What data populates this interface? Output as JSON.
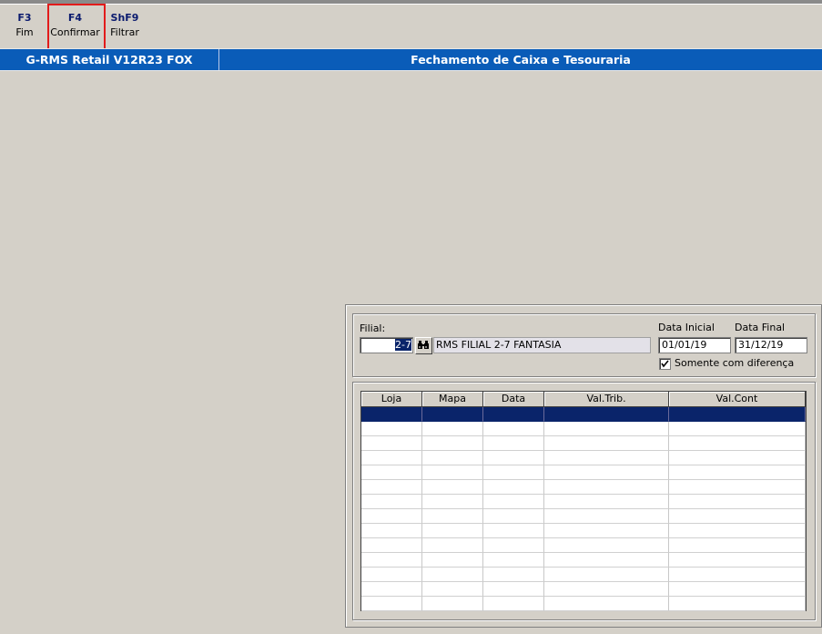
{
  "toolbar": {
    "keys": [
      {
        "key": "F3",
        "label": "Fim"
      },
      {
        "key": "F4",
        "label": "Confirmar"
      },
      {
        "key": "ShF9",
        "label": "Filtrar"
      }
    ]
  },
  "titlebar": {
    "app": "G-RMS Retail V12R23 FOX",
    "module": "Fechamento de Caixa e Tesouraria"
  },
  "filter": {
    "filial_label": "Filial:",
    "filial_value": "2-7",
    "filial_description": "RMS FILIAL 2-7 FANTASIA",
    "lookup_icon": "binoculars-icon",
    "data_inicial_label": "Data Inicial",
    "data_inicial_value": "01/01/19",
    "data_final_label": "Data Final",
    "data_final_value": "31/12/19",
    "somente_label": "Somente com diferença",
    "somente_checked": true
  },
  "grid": {
    "columns": [
      "Loja",
      "Mapa",
      "Data",
      "Val.Trib.",
      "Val.Cont"
    ],
    "rows": [
      [
        "",
        "",
        "",
        "",
        ""
      ],
      [
        "",
        "",
        "",
        "",
        ""
      ],
      [
        "",
        "",
        "",
        "",
        ""
      ],
      [
        "",
        "",
        "",
        "",
        ""
      ],
      [
        "",
        "",
        "",
        "",
        ""
      ],
      [
        "",
        "",
        "",
        "",
        ""
      ],
      [
        "",
        "",
        "",
        "",
        ""
      ],
      [
        "",
        "",
        "",
        "",
        ""
      ],
      [
        "",
        "",
        "",
        "",
        ""
      ],
      [
        "",
        "",
        "",
        "",
        ""
      ],
      [
        "",
        "",
        "",
        "",
        ""
      ],
      [
        "",
        "",
        "",
        "",
        ""
      ],
      [
        "",
        "",
        "",
        "",
        ""
      ],
      [
        "",
        "",
        "",
        "",
        ""
      ]
    ],
    "selected_row": 0
  },
  "colors": {
    "titlebar": "#0a5cb8",
    "selection": "#0a246a",
    "highlight_box": "#e21b1b",
    "window_bg": "#d4d0c8"
  }
}
